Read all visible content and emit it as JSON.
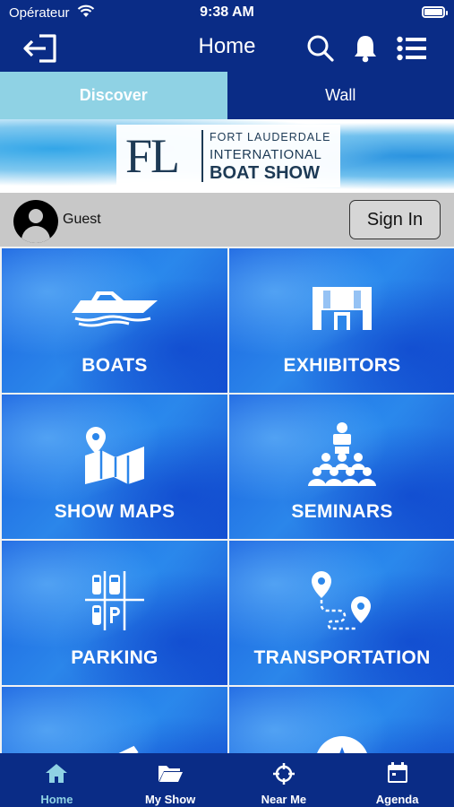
{
  "status_bar": {
    "carrier": "Opérateur",
    "time": "9:38 AM"
  },
  "nav": {
    "title": "Home",
    "icons": [
      "logout-icon",
      "search-icon",
      "bell-icon",
      "list-icon"
    ]
  },
  "tabs": [
    {
      "label": "Discover",
      "active": true
    },
    {
      "label": "Wall",
      "active": false
    }
  ],
  "banner": {
    "logo_letters": "FL",
    "line1": "FORT LAUDERDALE",
    "line2": "INTERNATIONAL",
    "line3": "BOAT SHOW"
  },
  "user": {
    "name": "Guest",
    "signin_label": "Sign In"
  },
  "tiles": [
    {
      "label": "BOATS",
      "icon": "boat-icon"
    },
    {
      "label": "EXHIBITORS",
      "icon": "booth-icon"
    },
    {
      "label": "SHOW MAPS",
      "icon": "map-icon"
    },
    {
      "label": "SEMINARS",
      "icon": "seminar-icon"
    },
    {
      "label": "PARKING",
      "icon": "parking-icon"
    },
    {
      "label": "TRANSPORTATION",
      "icon": "route-icon"
    },
    {
      "label": "",
      "icon": "ticket-icon"
    },
    {
      "label": "",
      "icon": "star-icon"
    }
  ],
  "bottom_nav": [
    {
      "label": "Home",
      "icon": "home-icon",
      "active": true
    },
    {
      "label": "My Show",
      "icon": "folder-icon",
      "active": false
    },
    {
      "label": "Near Me",
      "icon": "crosshair-icon",
      "active": false
    },
    {
      "label": "Agenda",
      "icon": "calendar-icon",
      "active": false
    }
  ],
  "colors": {
    "primary": "#0a2c86",
    "active_tab": "#8fd2e4",
    "tile_blue": "#1f6fe4",
    "userbar": "#c8c8c8"
  }
}
